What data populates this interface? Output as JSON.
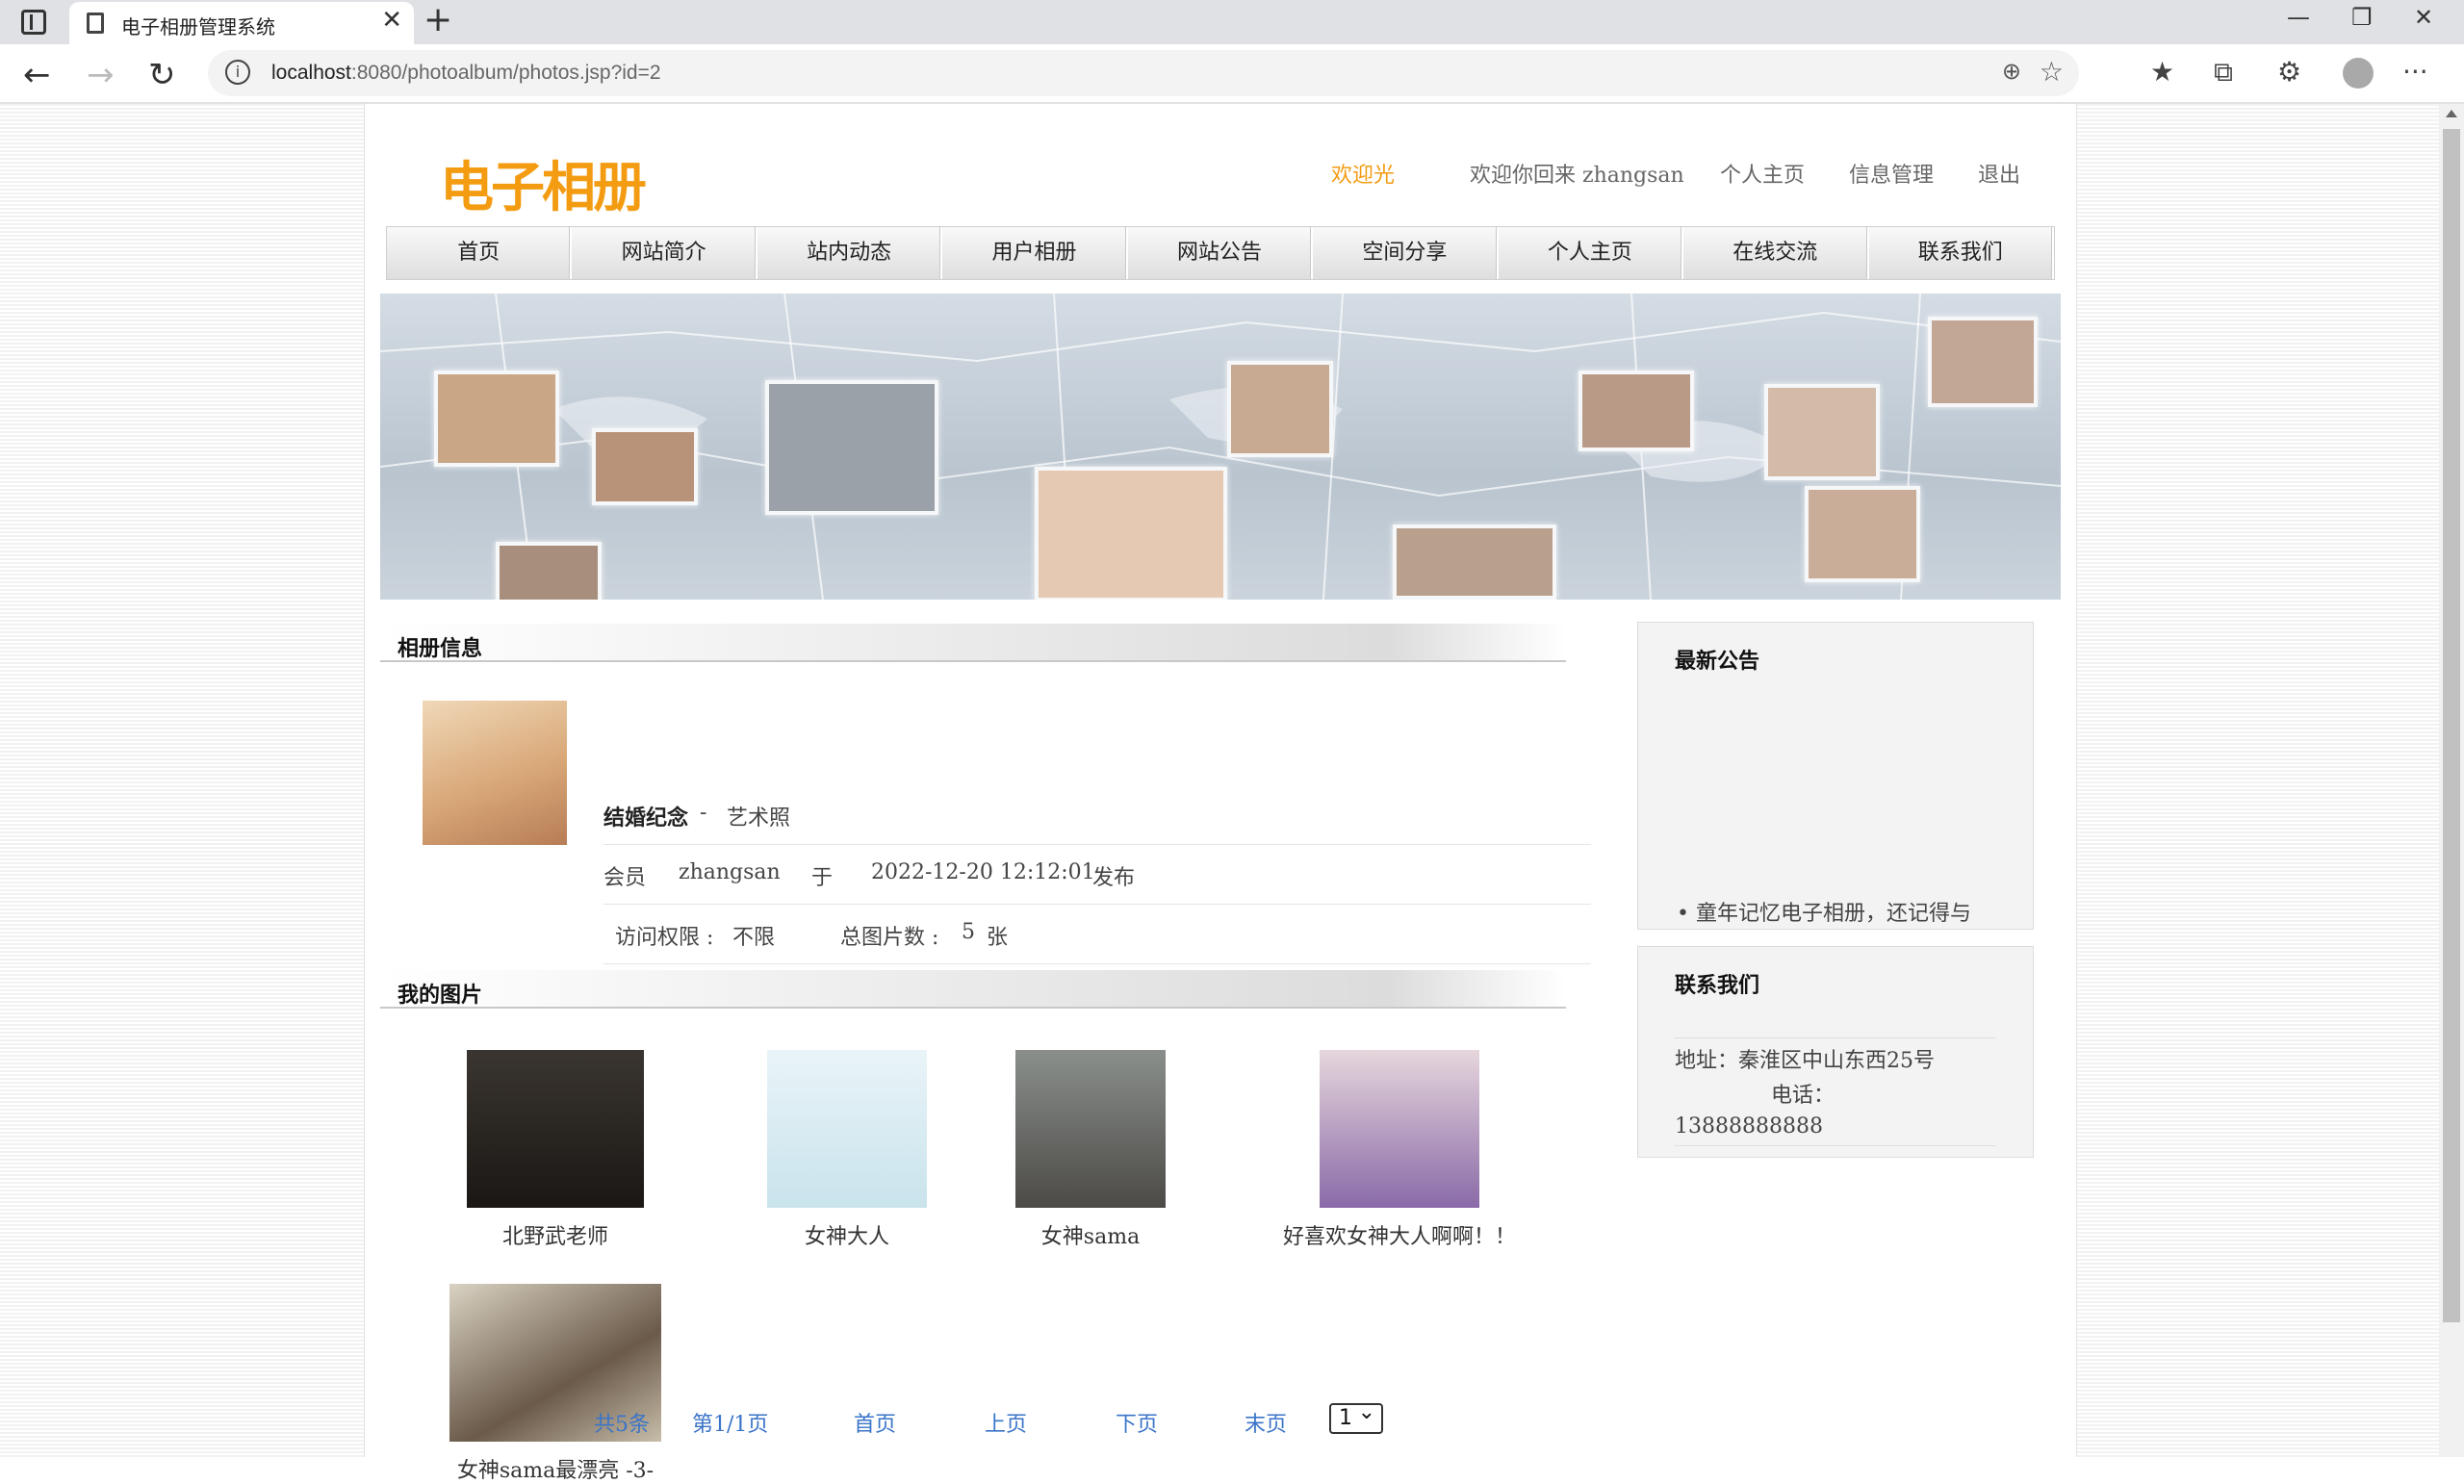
{
  "browser": {
    "tab_title": "电子相册管理系统",
    "tab_close": "✕",
    "new_tab": "+",
    "url_host": "localhost",
    "url_rest": ":8080/photoalbum/photos.jsp?id=2",
    "back": "←",
    "forward": "→",
    "reload": "↻",
    "minimize": "—",
    "restore": "❐",
    "close": "✕",
    "more": "···",
    "zoom_icon": "⊕",
    "favorite_icon": "☆",
    "favorites_icon": "★",
    "collections_icon": "⧉",
    "extensions_icon": "⚙"
  },
  "site": {
    "logo": "电子相册",
    "welcome_highlight": "欢迎光",
    "welcome_text": "欢迎你回来 zhangsan",
    "link_home": "个人主页",
    "link_manage": "信息管理",
    "link_logout": "退出"
  },
  "nav": {
    "items": [
      "首页",
      "网站简介",
      "站内动态",
      "用户相册",
      "网站公告",
      "空间分享",
      "个人主页",
      "在线交流",
      "联系我们"
    ]
  },
  "album": {
    "section_title": "相册信息",
    "name": "结婚纪念",
    "separator": "-",
    "category": "艺术照",
    "member_label": "会员",
    "member": "zhangsan",
    "at_label": "于",
    "date": "2022-12-20 12:12:01",
    "published": "发布",
    "access_label": "访问权限 :",
    "access_value": "不限",
    "count_label": "总图片数 :",
    "count_value": "5",
    "count_unit": "张"
  },
  "photos": {
    "section_title": "我的图片",
    "items": [
      "北野武老师",
      "女神大人",
      "女神sama",
      "好喜欢女神大人啊啊！！",
      "女神sama最漂亮 -3-"
    ]
  },
  "pager": {
    "total": "共5条",
    "page": "第1/1页",
    "first": "首页",
    "prev": "上页",
    "next": "下页",
    "last": "末页",
    "select_value": "1",
    "select_arrow": "⌄"
  },
  "sidebar": {
    "notice_title": "最新公告",
    "notice_item": "• 童年记忆电子相册，还记得与",
    "contact_title": "联系我们",
    "address": "地址：秦淮区中山东西25号",
    "phone_label": "电话：",
    "phone": "13888888888"
  },
  "colors": {
    "accent": "#f39c12",
    "link": "#3a74c8"
  }
}
